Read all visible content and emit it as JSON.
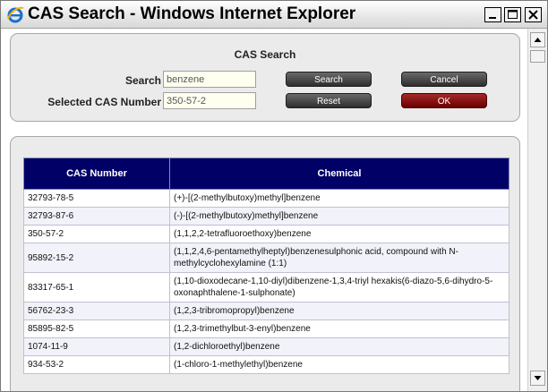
{
  "window": {
    "title": "CAS Search - Windows Internet Explorer"
  },
  "search_panel": {
    "title": "CAS Search",
    "search_label": "Search",
    "search_value": "benzene",
    "selected_label": "Selected CAS Number",
    "selected_value": "350-57-2",
    "search_button": "Search",
    "cancel_button": "Cancel",
    "reset_button": "Reset",
    "ok_button": "OK"
  },
  "results": {
    "headers": [
      "CAS Number",
      "Chemical"
    ],
    "rows": [
      {
        "cas": "32793-78-5",
        "chemical": "(+)-[(2-methylbutoxy)methyl]benzene"
      },
      {
        "cas": "32793-87-6",
        "chemical": "(-)-[(2-methylbutoxy)methyl]benzene"
      },
      {
        "cas": "350-57-2",
        "chemical": "(1,1,2,2-tetrafluoroethoxy)benzene"
      },
      {
        "cas": "95892-15-2",
        "chemical": "(1,1,2,4,6-pentamethylheptyl)benzenesulphonic acid, compound with N-methylcyclohexylamine (1:1)"
      },
      {
        "cas": "83317-65-1",
        "chemical": "(1,10-dioxodecane-1,10-diyl)dibenzene-1,3,4-triyl hexakis(6-diazo-5,6-dihydro-5-oxonaphthalene-1-sulphonate)"
      },
      {
        "cas": "56762-23-3",
        "chemical": "(1,2,3-tribromopropyl)benzene"
      },
      {
        "cas": "85895-82-5",
        "chemical": "(1,2,3-trimethylbut-3-enyl)benzene"
      },
      {
        "cas": "1074-11-9",
        "chemical": "(1,2-dichloroethyl)benzene"
      },
      {
        "cas": "934-53-2",
        "chemical": "(1-chloro-1-methylethyl)benzene"
      }
    ]
  }
}
